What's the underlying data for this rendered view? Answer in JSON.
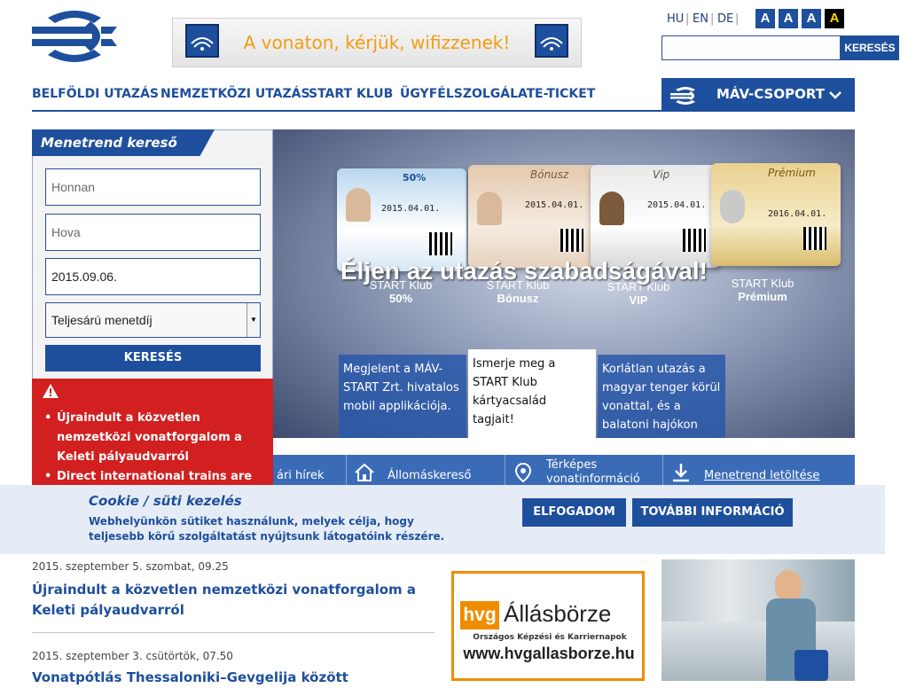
{
  "header": {
    "wifi_banner": "A vonaton, kérjük, wifizzenek!",
    "languages": [
      "HU",
      "EN",
      "DE"
    ],
    "accessibility": [
      "A",
      "A",
      "A",
      "A"
    ],
    "search_button": "KERESÉS"
  },
  "nav": {
    "items": [
      "BELFÖLDI UTAZÁS",
      "NEMZETKÖZI UTAZÁS",
      "START KLUB",
      "ÜGYFÉLSZOLGÁLAT",
      "E-TICKET"
    ],
    "group_label": "MÁV-CSOPORT"
  },
  "timetable": {
    "title": "Menetrend kereső",
    "from_placeholder": "Honnan",
    "to_placeholder": "Hova",
    "date_value": "2015.09.06.",
    "fare_value": "Teljesárú menetdíj",
    "search_button": "KERESÉS"
  },
  "alert": {
    "items": [
      "Újraindult a közvetlen nemzetközi vonatforgalom a Keleti pályaudvarról",
      "Direct international trains are"
    ]
  },
  "hero": {
    "slogan": "Éljen az utazás szabadságával!",
    "cards": [
      {
        "club": "START Klub",
        "name": "50%",
        "badge": "50%"
      },
      {
        "club": "START Klub",
        "name": "Bónusz",
        "badge": "Bónusz"
      },
      {
        "club": "START Klub",
        "name": "VIP",
        "badge": "Vip"
      },
      {
        "club": "START Klub",
        "name": "Prémium",
        "badge": "Prémium"
      }
    ],
    "card_dates": [
      "2015.04.01.",
      "2016.04.01."
    ],
    "promos": [
      "Megjelent a MÁV-START Zrt. hivatalos mobil applikációja.",
      "Ismerje meg a START Klub kártyacsalád tagjait!",
      "Korlátlan utazás a magyar tenger körül vonattal, és a balatoni hajókon"
    ]
  },
  "services": [
    {
      "label": "ári hírek"
    },
    {
      "label": "Állomáskereső"
    },
    {
      "label": "Térképes vonatinformáció"
    },
    {
      "label": "Menetrend letöltése"
    }
  ],
  "cookie": {
    "title": "Cookie / süti kezelés",
    "text": "Webhelyünkön sütiket használunk, melyek célja, hogy teljesebb körű szolgáltatást nyújtsunk látogatóink részére.",
    "accept": "ELFOGADOM",
    "more": "TOVÁBBI INFORMÁCIÓ"
  },
  "news": [
    {
      "date": "2015. szeptember 5. szombat, 09.25",
      "title": "Újraindult a közvetlen nemzetközi vonatforgalom a Keleti pályaudvarról"
    },
    {
      "date": "2015. szeptember 3. csütörtök, 07.50",
      "title": "Vonatpótlás Thessaloniki–Gevgelija között"
    }
  ],
  "hvg_ad": {
    "logo": "hvg",
    "title": "Állásbörze",
    "subtitle": "Országos Képzési és Karriernapok",
    "url": "www.hvgallasborze.hu"
  },
  "colors": {
    "brand": "#1e4f9c",
    "alert": "#d21f1f",
    "accent": "#f39c12"
  }
}
